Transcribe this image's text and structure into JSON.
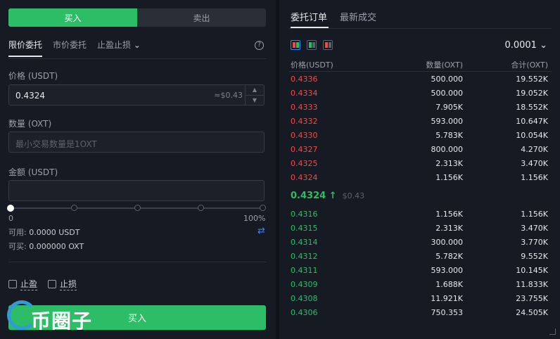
{
  "trade": {
    "tab_buy": "买入",
    "tab_sell": "卖出",
    "order_types": [
      "限价委托",
      "市价委托",
      "止盈止损"
    ],
    "help": "?",
    "price_label": "价格 (USDT)",
    "price_value": "0.4324",
    "price_hint": "≈$0.43",
    "qty_label": "数量 (OXT)",
    "qty_placeholder": "最小交易数量是1OXT",
    "amount_label": "金额 (USDT)",
    "amount_value": "",
    "slider_min": "0",
    "slider_max": "100%",
    "slider_percent": 0,
    "available_label": "可用:",
    "available_value": "0.0000 USDT",
    "buyable_label": "可买:",
    "buyable_value": "0.000000 OXT",
    "take_profit": "止盈",
    "stop_loss": "止损",
    "submit": "买入",
    "watermark": "币圈子"
  },
  "book": {
    "tab_active": "委托订单",
    "tab_other": "最新成交",
    "precision": "0.0001",
    "col_price": "价格(USDT)",
    "col_qty": "数量(OXT)",
    "col_total": "合计(OXT)",
    "asks": [
      {
        "price": "0.4336",
        "qty": "500.000",
        "total": "19.552K"
      },
      {
        "price": "0.4334",
        "qty": "500.000",
        "total": "19.052K"
      },
      {
        "price": "0.4333",
        "qty": "7.905K",
        "total": "18.552K"
      },
      {
        "price": "0.4332",
        "qty": "593.000",
        "total": "10.647K"
      },
      {
        "price": "0.4330",
        "qty": "5.783K",
        "total": "10.054K"
      },
      {
        "price": "0.4327",
        "qty": "800.000",
        "total": "4.270K"
      },
      {
        "price": "0.4325",
        "qty": "2.313K",
        "total": "3.470K"
      },
      {
        "price": "0.4324",
        "qty": "1.156K",
        "total": "1.156K"
      }
    ],
    "last_price": "0.4324",
    "last_arrow": "↑",
    "last_usd": "$0.43",
    "bids": [
      {
        "price": "0.4316",
        "qty": "1.156K",
        "total": "1.156K"
      },
      {
        "price": "0.4315",
        "qty": "2.313K",
        "total": "3.470K"
      },
      {
        "price": "0.4314",
        "qty": "300.000",
        "total": "3.770K"
      },
      {
        "price": "0.4312",
        "qty": "5.782K",
        "total": "9.552K"
      },
      {
        "price": "0.4311",
        "qty": "593.000",
        "total": "10.145K"
      },
      {
        "price": "0.4309",
        "qty": "1.688K",
        "total": "11.833K"
      },
      {
        "price": "0.4308",
        "qty": "11.921K",
        "total": "23.755K"
      },
      {
        "price": "0.4306",
        "qty": "750.353",
        "total": "24.505K"
      }
    ]
  },
  "colors": {
    "buy": "#2ebd67",
    "sell": "#f24a4a",
    "accent": "#3b82f6"
  }
}
